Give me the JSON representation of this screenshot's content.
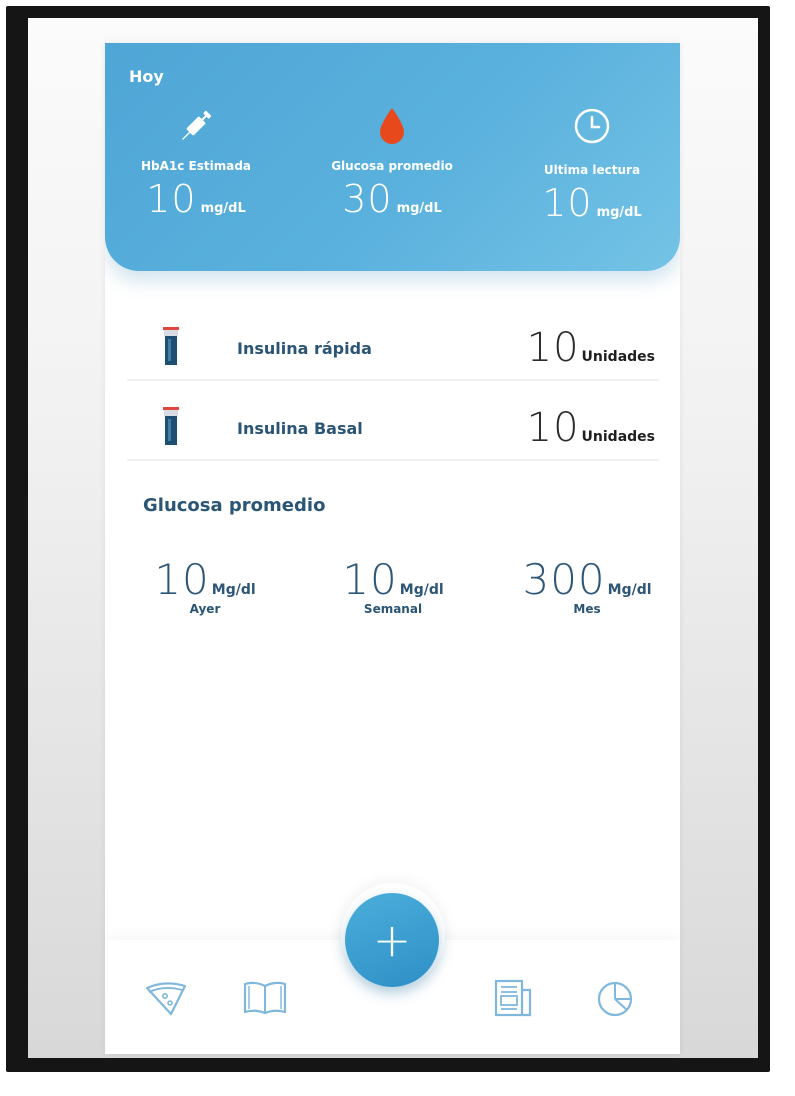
{
  "header": {
    "title": "Hoy",
    "stats": [
      {
        "icon": "syringe-icon",
        "label": "HbA1c Estimada",
        "value": "10",
        "unit": "mg/dL"
      },
      {
        "icon": "blood-drop-icon",
        "label": "Glucosa promedio",
        "value": "30",
        "unit": "mg/dL"
      },
      {
        "icon": "clock-icon",
        "label": "Ultima lectura",
        "value": "10",
        "unit": "mg/dL"
      }
    ]
  },
  "insulin": [
    {
      "icon": "insulin-vial-icon",
      "name": "Insulina rápida",
      "value": "10",
      "unit": "Unidades"
    },
    {
      "icon": "insulin-vial-icon",
      "name": "Insulina Basal",
      "value": "10",
      "unit": "Unidades"
    }
  ],
  "average": {
    "title": "Glucosa promedio",
    "items": [
      {
        "value": "10",
        "unit": "Mg/dl",
        "label": "Ayer"
      },
      {
        "value": "10",
        "unit": "Mg/dl",
        "label": "Semanal"
      },
      {
        "value": "300",
        "unit": "Mg/dl",
        "label": "Mes"
      }
    ]
  },
  "fab": {
    "symbol": "+",
    "icon": "plus-icon"
  },
  "nav": [
    "pizza-slice-icon",
    "open-book-icon",
    "news-icon",
    "pie-chart-icon"
  ],
  "colors": {
    "header_start": "#4fa6d6",
    "header_end": "#74c3e6",
    "accent_dark": "#2b5575",
    "drop": "#e8491c",
    "nav_icon": "#7fb8dc"
  }
}
